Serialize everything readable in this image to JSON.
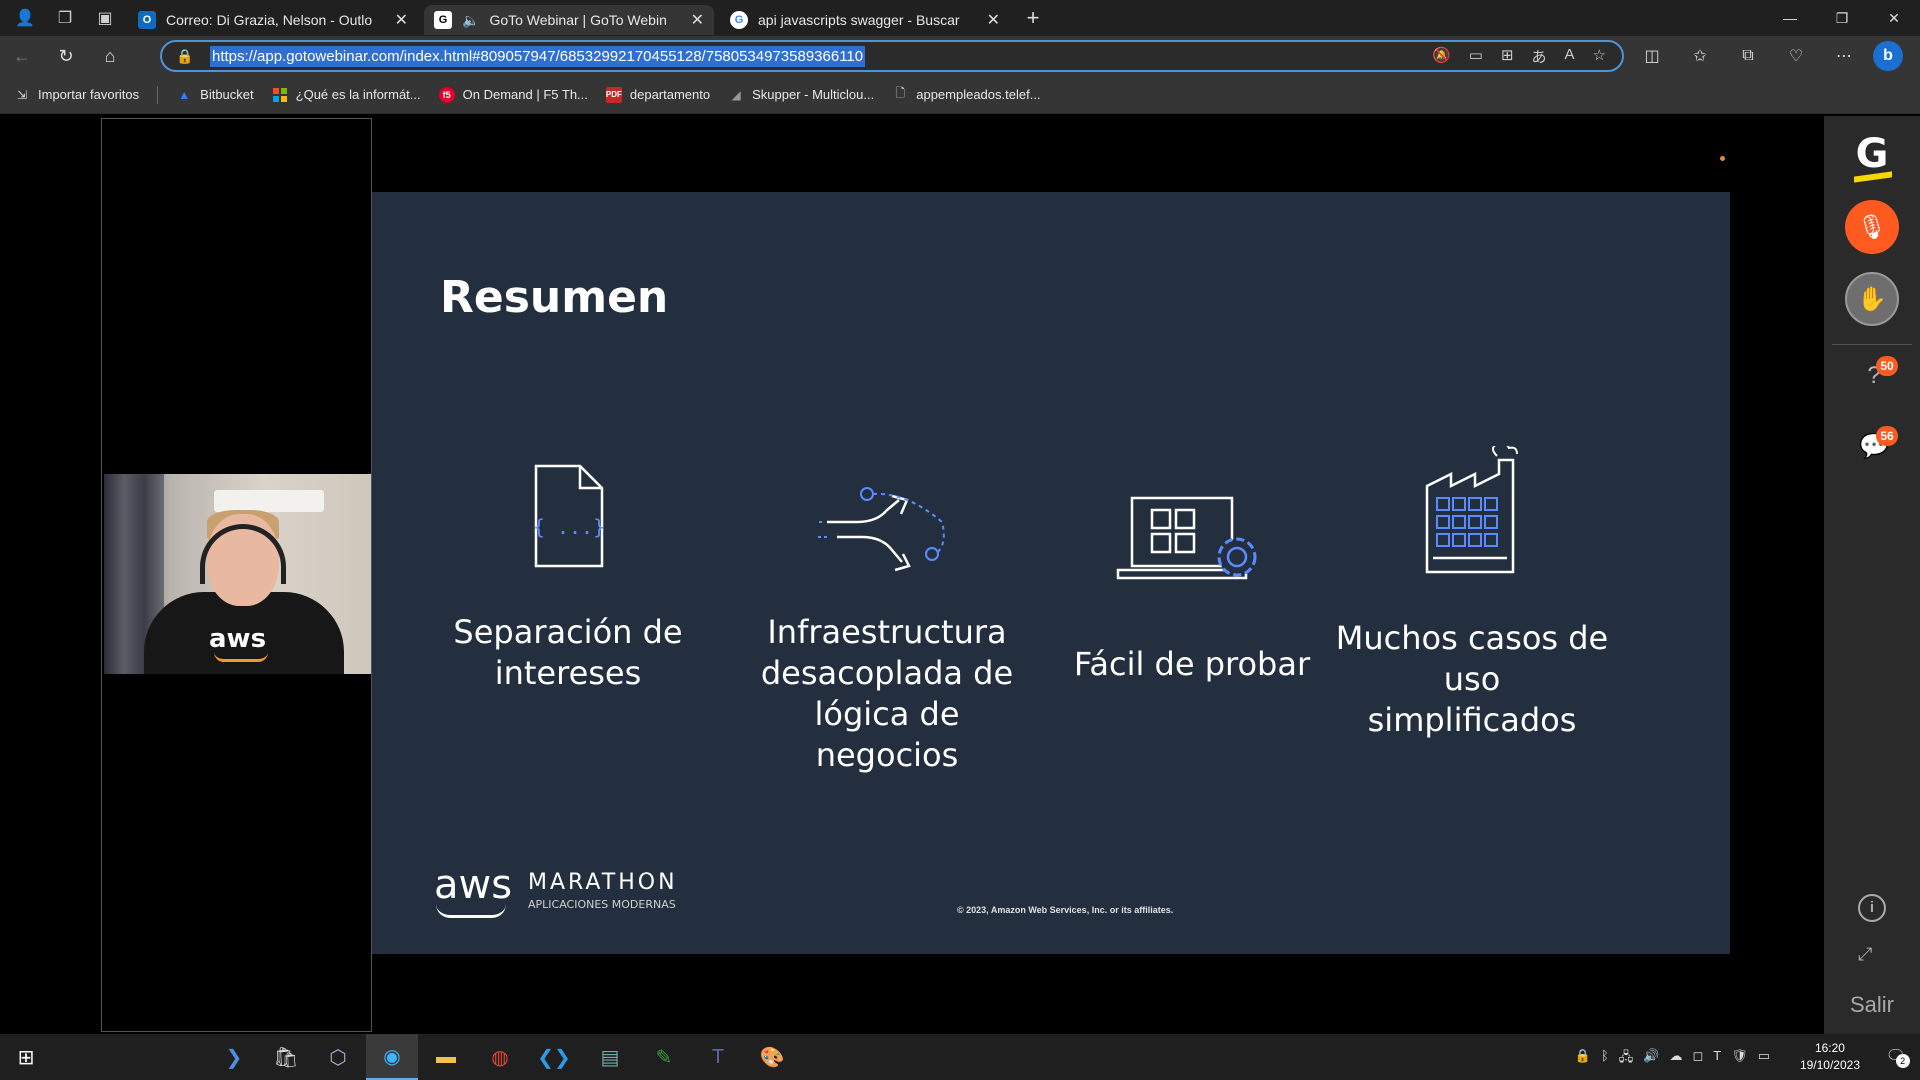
{
  "browser": {
    "tabs": [
      {
        "title": "Correo: Di Grazia, Nelson - Outlo",
        "favicon": "outlook-icon",
        "active": false
      },
      {
        "title": "GoTo Webinar | GoTo Webin",
        "favicon": "goto-icon",
        "active": true
      },
      {
        "title": "api javascripts swagger - Buscar",
        "favicon": "google-icon",
        "active": false
      }
    ],
    "url": "https://app.gotowebinar.com/index.html#809057947/6853299217045512 8/7580534973589366110",
    "url_display": "https://app.gotowebinar.com/index.html#809057947/6853299217045512​8/7580534973589366110",
    "bookmarks": [
      {
        "label": "Importar favoritos",
        "icon": "import-icon"
      },
      {
        "label": "Bitbucket",
        "icon": "bitbucket-icon"
      },
      {
        "label": "¿Qué es la informát...",
        "icon": "microsoft-icon"
      },
      {
        "label": "On Demand | F5 Th...",
        "icon": "f5-icon"
      },
      {
        "label": "departamento",
        "icon": "pdf-icon"
      },
      {
        "label": "Skupper - Multiclou...",
        "icon": "skupper-icon"
      },
      {
        "label": "appempleados.telef...",
        "icon": "page-icon"
      }
    ]
  },
  "slide": {
    "title": "Resumen",
    "items": [
      {
        "label_line1": "Separación de",
        "label_line2": "intereses",
        "label_line3": ""
      },
      {
        "label_line1": "Infraestructura",
        "label_line2": "desacoplada de",
        "label_line3": "lógica de negocios"
      },
      {
        "label_line1": "Fácil de probar",
        "label_line2": "",
        "label_line3": ""
      },
      {
        "label_line1": "Muchos casos de uso",
        "label_line2": "simplificados",
        "label_line3": ""
      }
    ],
    "brand": "aws",
    "event": "MARATHON",
    "event_sub": "APLICACIONES MODERNAS",
    "copyright": "© 2023, Amazon Web Services, Inc. or its affiliates.",
    "shirt_text": "aws"
  },
  "sidebar": {
    "logo": "G",
    "questions_count": "50",
    "chat_count": "56",
    "exit_label": "Salir"
  },
  "taskbar": {
    "time": "16:20",
    "date": "19/10/2023",
    "notifications": "2"
  },
  "colors": {
    "slide_bg": "#232f3e",
    "mic_button": "#ff5a1f",
    "url_highlight": "#2f6fd0",
    "goto_yellow": "#f4d800"
  }
}
